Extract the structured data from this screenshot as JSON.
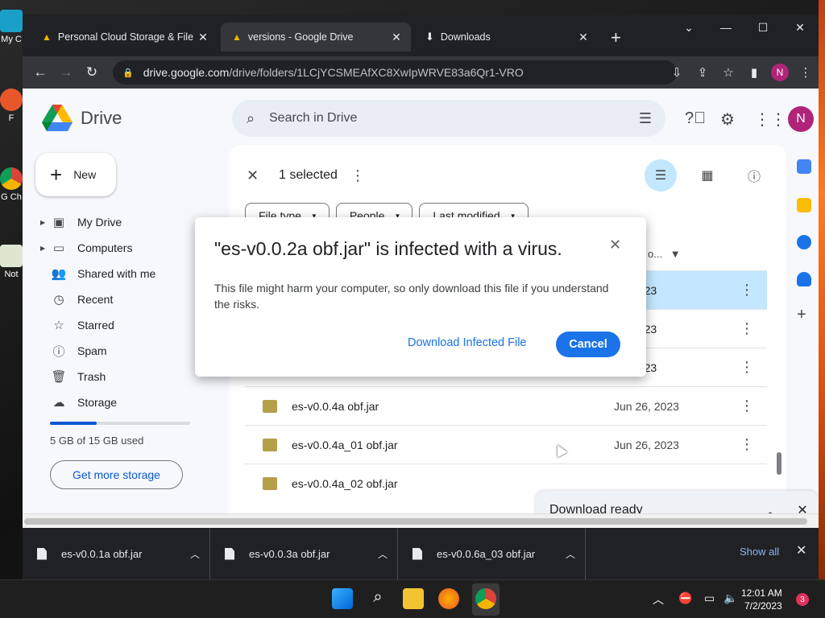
{
  "desktop": {
    "icons": [
      {
        "label": "My C"
      },
      {
        "label": "F"
      },
      {
        "label": "G\nCh"
      },
      {
        "label": "Not"
      }
    ]
  },
  "browser": {
    "tabs": [
      {
        "label": "Personal Cloud Storage & File Sh",
        "active": false
      },
      {
        "label": "versions - Google Drive",
        "active": true
      },
      {
        "label": "Downloads",
        "active": false
      }
    ],
    "newtab": "+",
    "url_host": "drive.google.com",
    "url_path": "/drive/folders/1LCjYCSMEAfXC8XwIpWRVE83a6Qr1-VRO",
    "profile_initial": "N"
  },
  "drive": {
    "logo_text": "Drive",
    "search_placeholder": "Search in Drive",
    "account_initial": "N",
    "new_label": "New",
    "nav": [
      {
        "label": "My Drive",
        "icon": "my-drive-icon",
        "caret": true
      },
      {
        "label": "Computers",
        "icon": "computers-icon",
        "caret": true
      },
      {
        "label": "Shared with me",
        "icon": "shared-icon",
        "caret": false
      },
      {
        "label": "Recent",
        "icon": "clock-icon",
        "caret": false
      },
      {
        "label": "Starred",
        "icon": "star-icon",
        "caret": false
      },
      {
        "label": "Spam",
        "icon": "spam-icon",
        "caret": false
      },
      {
        "label": "Trash",
        "icon": "trash-icon",
        "caret": false
      },
      {
        "label": "Storage",
        "icon": "cloud-icon",
        "caret": false
      }
    ],
    "storage_used_fraction": 0.333,
    "storage_text": "5 GB of 15 GB used",
    "get_more_storage": "Get more storage",
    "selection_text": "1 selected",
    "chips": [
      {
        "label": "File type"
      },
      {
        "label": "People"
      },
      {
        "label": "Last modified"
      }
    ],
    "sort_header": "o...",
    "rows": [
      {
        "name": "",
        "date": "2023",
        "selected": true
      },
      {
        "name": "",
        "date": "2023",
        "selected": false
      },
      {
        "name": "",
        "date": "2023",
        "selected": false
      },
      {
        "name": "es-v0.0.4a obf.jar",
        "date": "Jun 26, 2023",
        "selected": false
      },
      {
        "name": "es-v0.0.4a_01 obf.jar",
        "date": "Jun 26, 2023",
        "selected": false
      },
      {
        "name": "es-v0.0.4a_02 obf.jar",
        "date": "",
        "selected": false
      }
    ],
    "download_ready": "Download ready"
  },
  "dialog": {
    "title": "\"es-v0.0.2a obf.jar\" is infected with a virus.",
    "body": "This file might harm your computer, so only download this file if you understand the risks.",
    "download_label": "Download Infected File",
    "cancel_label": "Cancel"
  },
  "shelf": {
    "items": [
      {
        "name": "es-v0.0.1a obf.jar"
      },
      {
        "name": "es-v0.0.3a obf.jar"
      },
      {
        "name": "es-v0.0.6a_03 obf.jar"
      }
    ],
    "show_all": "Show all"
  },
  "taskbar": {
    "time": "12:01 AM",
    "date": "7/2/2023",
    "notifications": "3"
  },
  "colors": {
    "accent": "#1a73e8",
    "selected_row": "#c2e7ff",
    "avatar": "#b0247a"
  }
}
